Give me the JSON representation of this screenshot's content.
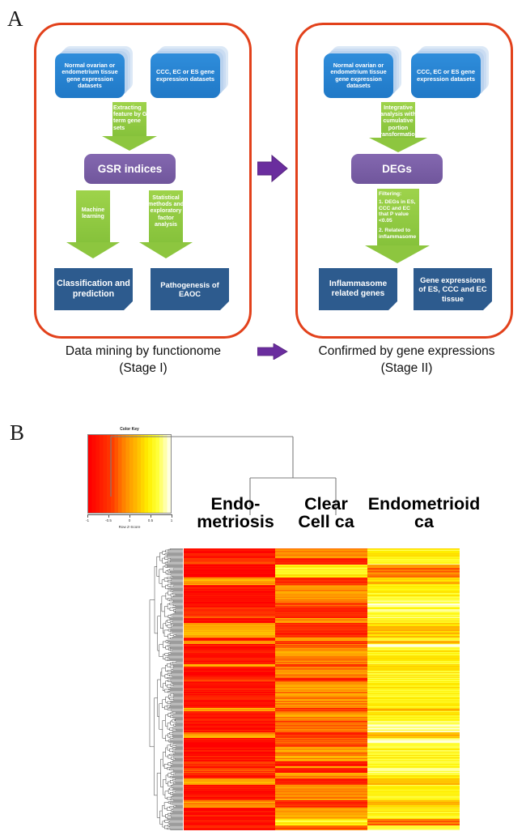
{
  "figure": {
    "panel_a_label": "A",
    "panel_b_label": "B"
  },
  "panel_a": {
    "stage1": {
      "dataset_left": "Normal ovarian or endometrium tissue gene expression datasets",
      "dataset_right": "CCC, EC or ES gene expression datasets",
      "arrow_top": "Extracting feature by GO term gene sets",
      "central_node": "GSR indices",
      "arrow_left": "Machine learning",
      "arrow_right": "Statistical methods and exploratory factor analysis",
      "result_left": "Classification and prediction",
      "result_right": "Pathogenesis of EAOC",
      "caption_line1": "Data mining by functionome",
      "caption_line2": "(Stage I)"
    },
    "stage2": {
      "dataset_left": "Normal ovarian or endometrium tissue gene expression datasets",
      "dataset_right": "CCC, EC or ES gene expression datasets",
      "arrow_top": "Integrative analysis with cumulative portion transformation",
      "central_node": "DEGs",
      "arrow_filter_title": "Filtering:",
      "arrow_filter_item1": "1.   DEGs in ES, CCC and EC that P value <0.05",
      "arrow_filter_item2": "2.   Related to inflammasome",
      "result_left": "Inflammasome related genes",
      "result_right": "Gene expressions of ES, CCC and EC tissue",
      "caption_line1": "Confirmed by gene expressions",
      "caption_line2": "(Stage II)"
    },
    "connector_icon": "right-arrow-icon",
    "colors": {
      "frame_border": "#e2411b",
      "dataset_blue": "#2079c7",
      "arrow_green": "#8dc63f",
      "node_purple": "#70569c",
      "result_navy": "#2d5b8e",
      "connector_purple": "#6a2d9e"
    }
  },
  "panel_b": {
    "color_key": {
      "title": "Color Key",
      "xlabel": "Row Z-Score",
      "ticks": [
        "-1",
        "-0.5",
        "0",
        "0.5",
        "1"
      ]
    },
    "column_labels": [
      {
        "line1": "Endo-",
        "line2": "metriosis"
      },
      {
        "line1": "Clear",
        "line2": "Cell  ca"
      },
      {
        "line1": "Endometrioid",
        "line2": "ca"
      }
    ],
    "chart_data": {
      "type": "heatmap",
      "title": "",
      "xlabel": "",
      "ylabel": "",
      "colorbar_label": "Row Z-Score",
      "colorbar_range": [
        -1,
        1
      ],
      "colorbar_ticks": [
        -1,
        -0.5,
        0,
        0.5,
        1
      ],
      "colormap": [
        "#ff0000",
        "#ff3300",
        "#ff6600",
        "#ff9900",
        "#ffcc00",
        "#ffff00",
        "#ffff66",
        "#ffffcc",
        "#ffffff"
      ],
      "categories": [
        "Endometriosis",
        "Clear Cell ca",
        "Endometrioid ca"
      ],
      "grid": false,
      "legend_position": "top-left",
      "row_count": 300,
      "row_dendrogram": true,
      "column_dendrogram": {
        "type": "dendrogram",
        "leaves": [
          "Endometriosis",
          "Clear Cell ca",
          "Endometrioid ca"
        ],
        "merges": [
          {
            "left": "Clear Cell ca",
            "right": "Endometrioid ca",
            "height": 0.42
          },
          {
            "left": "Endometriosis",
            "right": "cluster1",
            "height": 1.0
          }
        ]
      },
      "series": [
        {
          "name": "Endometriosis",
          "mean_z": -0.82,
          "range": [
            -1.0,
            0.45
          ]
        },
        {
          "name": "Clear Cell ca",
          "mean_z": -0.05,
          "range": [
            -1.0,
            0.95
          ]
        },
        {
          "name": "Endometrioid ca",
          "mean_z": 0.55,
          "range": [
            -0.9,
            1.0
          ]
        }
      ],
      "values": [
        [
          -0.95,
          -0.3,
          0.7
        ],
        [
          -0.92,
          -0.22,
          0.55
        ],
        [
          -0.9,
          -0.1,
          0.8
        ],
        [
          -0.96,
          -0.45,
          0.62
        ],
        [
          -0.88,
          -0.05,
          0.9
        ],
        [
          -0.94,
          -0.35,
          0.48
        ],
        [
          -0.91,
          0.1,
          0.86
        ],
        [
          -0.97,
          -0.5,
          0.66
        ],
        [
          -0.85,
          0.05,
          0.92
        ],
        [
          -0.93,
          -0.28,
          0.58
        ],
        [
          -0.9,
          -0.15,
          0.75
        ],
        [
          -0.96,
          -0.4,
          0.52
        ],
        [
          -0.89,
          0.18,
          0.88
        ],
        [
          -0.95,
          -0.32,
          0.6
        ],
        [
          -0.87,
          0.02,
          0.94
        ],
        [
          -0.92,
          -0.2,
          0.72
        ],
        [
          -0.98,
          -0.55,
          0.45
        ],
        [
          -0.86,
          0.22,
          0.96
        ],
        [
          -0.94,
          -0.38,
          0.64
        ],
        [
          -0.9,
          -0.08,
          0.82
        ],
        [
          -0.55,
          -0.85,
          0.35
        ],
        [
          -0.4,
          -0.92,
          0.2
        ],
        [
          -0.3,
          -0.95,
          0.15
        ],
        [
          -0.6,
          -0.88,
          0.42
        ],
        [
          -0.25,
          -0.9,
          0.05
        ],
        [
          -0.45,
          -0.93,
          0.28
        ],
        [
          -0.35,
          -0.87,
          0.18
        ],
        [
          -0.92,
          0.3,
          0.4
        ],
        [
          -0.88,
          0.45,
          0.25
        ],
        [
          -0.95,
          0.15,
          0.68
        ]
      ]
    }
  }
}
